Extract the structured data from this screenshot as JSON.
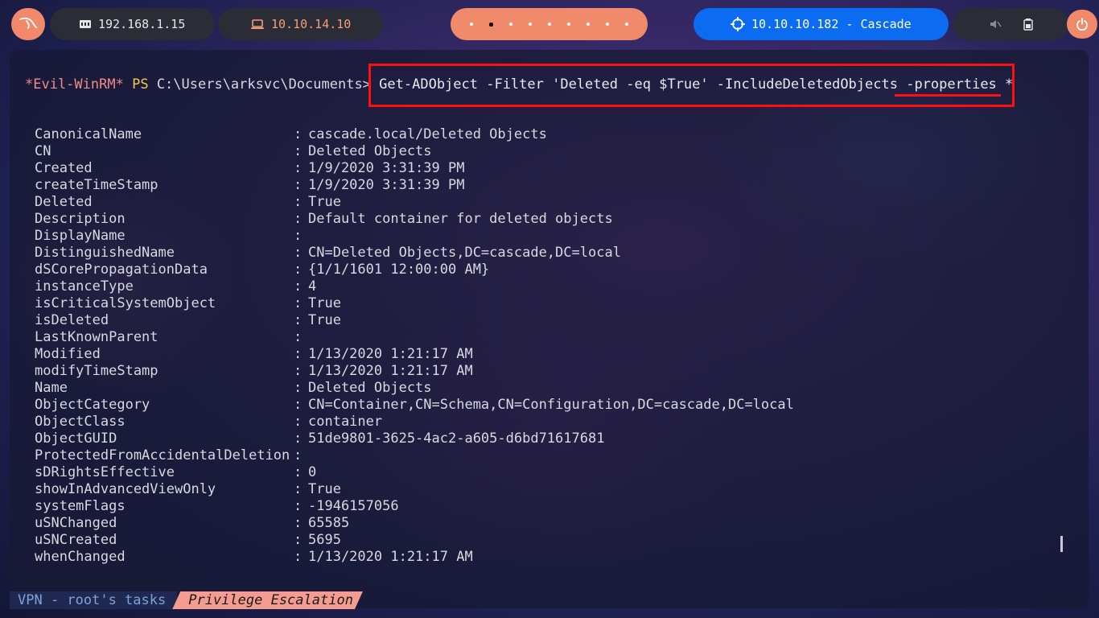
{
  "topbar": {
    "ip_local": "192.168.1.15",
    "ip_vpn": "10.10.14.10",
    "workspace_count": 9,
    "active_workspace": 2,
    "target": "10.10.10.182 - Cascade"
  },
  "terminal": {
    "prompt_shell": "*Evil-WinRM*",
    "prompt_ps": "PS",
    "prompt_path": "C:\\Users\\arksvc\\Documents>",
    "command": "Get-ADObject -Filter 'Deleted -eq $True' -IncludeDeletedObjects -properties *",
    "properties": [
      {
        "key": "CanonicalName",
        "value": "cascade.local/Deleted Objects"
      },
      {
        "key": "CN",
        "value": "Deleted Objects"
      },
      {
        "key": "Created",
        "value": "1/9/2020 3:31:39 PM"
      },
      {
        "key": "createTimeStamp",
        "value": "1/9/2020 3:31:39 PM"
      },
      {
        "key": "Deleted",
        "value": "True"
      },
      {
        "key": "Description",
        "value": "Default container for deleted objects"
      },
      {
        "key": "DisplayName",
        "value": ""
      },
      {
        "key": "DistinguishedName",
        "value": "CN=Deleted Objects,DC=cascade,DC=local"
      },
      {
        "key": "dSCorePropagationData",
        "value": "{1/1/1601 12:00:00 AM}"
      },
      {
        "key": "instanceType",
        "value": "4"
      },
      {
        "key": "isCriticalSystemObject",
        "value": "True"
      },
      {
        "key": "isDeleted",
        "value": "True"
      },
      {
        "key": "LastKnownParent",
        "value": ""
      },
      {
        "key": "Modified",
        "value": "1/13/2020 1:21:17 AM"
      },
      {
        "key": "modifyTimeStamp",
        "value": "1/13/2020 1:21:17 AM"
      },
      {
        "key": "Name",
        "value": "Deleted Objects"
      },
      {
        "key": "ObjectCategory",
        "value": "CN=Container,CN=Schema,CN=Configuration,DC=cascade,DC=local"
      },
      {
        "key": "ObjectClass",
        "value": "container"
      },
      {
        "key": "ObjectGUID",
        "value": "51de9801-3625-4ac2-a605-d6bd71617681"
      },
      {
        "key": "ProtectedFromAccidentalDeletion",
        "value": ""
      },
      {
        "key": "sDRightsEffective",
        "value": "0"
      },
      {
        "key": "showInAdvancedViewOnly",
        "value": "True"
      },
      {
        "key": "systemFlags",
        "value": "-1946157056"
      },
      {
        "key": "uSNChanged",
        "value": "65585"
      },
      {
        "key": "uSNCreated",
        "value": "5695"
      },
      {
        "key": "whenChanged",
        "value": "1/13/2020 1:21:17 AM"
      }
    ]
  },
  "statusline": {
    "session": "VPN - root's tasks",
    "window": "Privilege Escalation"
  },
  "colors": {
    "accent": "#f08a6a",
    "target_pill": "#0b6cf2",
    "highlight": "#ff1010"
  }
}
